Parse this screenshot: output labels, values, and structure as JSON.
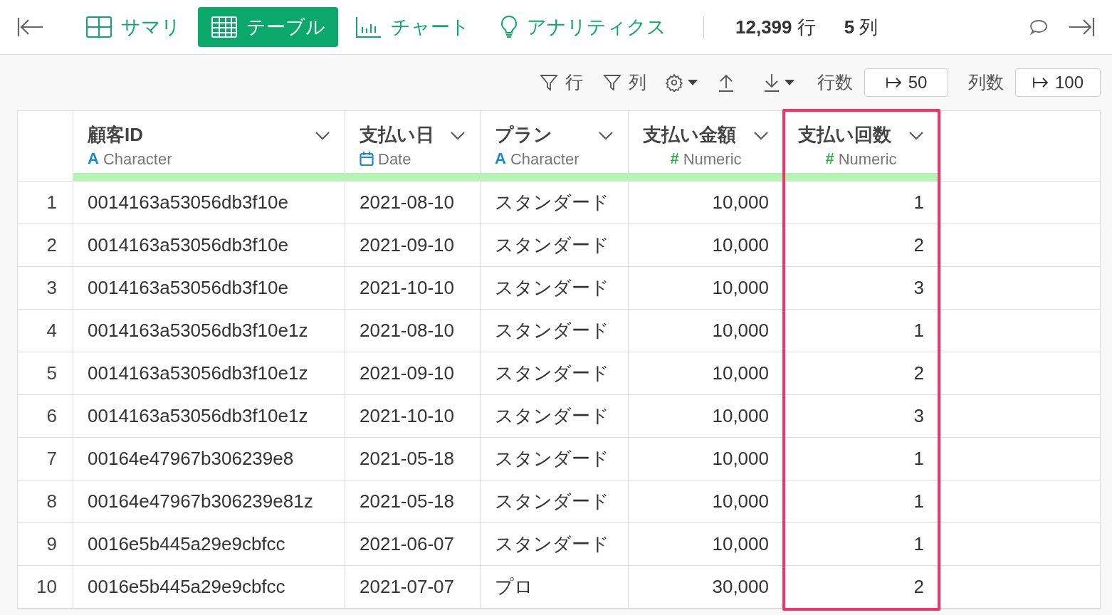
{
  "nav": {
    "tabs": [
      {
        "label": "サマリ",
        "selected": false
      },
      {
        "label": "テーブル",
        "selected": true
      },
      {
        "label": "チャート",
        "selected": false
      },
      {
        "label": "アナリティクス",
        "selected": false
      }
    ],
    "row_count": "12,399",
    "row_unit": "行",
    "col_count": "5",
    "col_unit": "列"
  },
  "toolbar": {
    "row_filter": "行",
    "col_filter": "列",
    "rows_label": "行数",
    "rows_value": "50",
    "cols_label": "列数",
    "cols_value": "100"
  },
  "table": {
    "columns": [
      {
        "name": "顧客ID",
        "type": "Character",
        "kind": "character",
        "type_mark": "A",
        "highlighted": false
      },
      {
        "name": "支払い日",
        "type": "Date",
        "kind": "date",
        "highlighted": false
      },
      {
        "name": "プラン",
        "type": "Character",
        "kind": "character",
        "type_mark": "A",
        "highlighted": false
      },
      {
        "name": "支払い金額",
        "type": "Numeric",
        "kind": "numeric",
        "type_mark": "#",
        "highlighted": false
      },
      {
        "name": "支払い回数",
        "type": "Numeric",
        "kind": "numeric",
        "type_mark": "#",
        "highlighted": true
      }
    ],
    "rows": [
      {
        "index": "1",
        "cells": [
          "0014163a53056db3f10e",
          "2021-08-10",
          "スタンダード",
          "10,000",
          "1"
        ]
      },
      {
        "index": "2",
        "cells": [
          "0014163a53056db3f10e",
          "2021-09-10",
          "スタンダード",
          "10,000",
          "2"
        ]
      },
      {
        "index": "3",
        "cells": [
          "0014163a53056db3f10e",
          "2021-10-10",
          "スタンダード",
          "10,000",
          "3"
        ]
      },
      {
        "index": "4",
        "cells": [
          "0014163a53056db3f10e1z",
          "2021-08-10",
          "スタンダード",
          "10,000",
          "1"
        ]
      },
      {
        "index": "5",
        "cells": [
          "0014163a53056db3f10e1z",
          "2021-09-10",
          "スタンダード",
          "10,000",
          "2"
        ]
      },
      {
        "index": "6",
        "cells": [
          "0014163a53056db3f10e1z",
          "2021-10-10",
          "スタンダード",
          "10,000",
          "3"
        ]
      },
      {
        "index": "7",
        "cells": [
          "00164e47967b306239e8",
          "2021-05-18",
          "スタンダード",
          "10,000",
          "1"
        ]
      },
      {
        "index": "8",
        "cells": [
          "00164e47967b306239e81z",
          "2021-05-18",
          "スタンダード",
          "10,000",
          "1"
        ]
      },
      {
        "index": "9",
        "cells": [
          "0016e5b445a29e9cbfcc",
          "2021-06-07",
          "スタンダード",
          "10,000",
          "1"
        ]
      },
      {
        "index": "10",
        "cells": [
          "0016e5b445a29e9cbfcc",
          "2021-07-07",
          "プロ",
          "30,000",
          "2"
        ]
      }
    ]
  }
}
